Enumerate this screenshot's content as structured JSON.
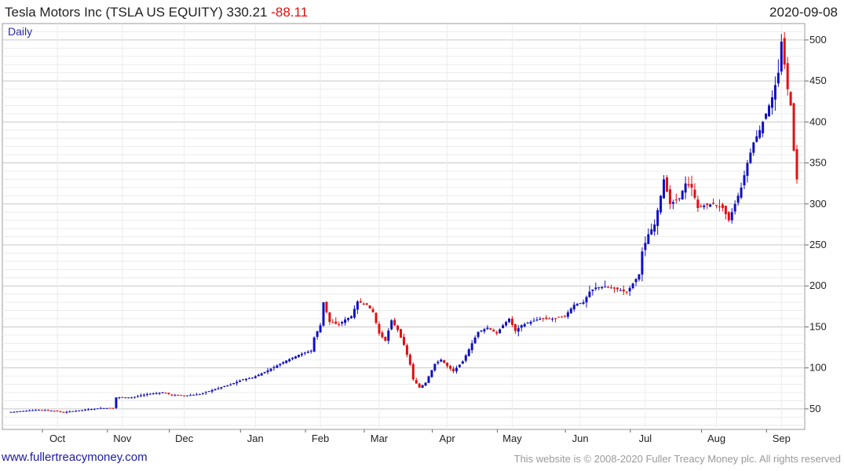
{
  "header": {
    "title": "Tesla Motors Inc (TSLA US EQUITY)",
    "last": "330.21",
    "change": "-88.11",
    "date": "2020-09-08"
  },
  "footer": {
    "site": "www.fullertreacymoney.com",
    "copyright": "This website is © 2008-2020 Fuller Treacy Money plc. All rights reserved"
  },
  "colors": {
    "up": "#1010c0",
    "down": "#e01010",
    "grid": "#d6d6d6"
  },
  "chart_data": {
    "type": "candlestick",
    "period_label": "Daily",
    "ylim": [
      25,
      520
    ],
    "yticks": [
      50,
      100,
      150,
      200,
      250,
      300,
      350,
      400,
      450,
      500
    ],
    "grid": true,
    "axis_side": "right",
    "months": [
      "Oct",
      "Nov",
      "Dec",
      "Jan",
      "Feb",
      "Mar",
      "Apr",
      "May",
      "Jun",
      "Jul",
      "Aug",
      "Sep"
    ],
    "month_index": [
      16,
      37,
      57,
      80,
      101,
      120,
      142,
      163,
      185,
      206,
      229,
      250
    ],
    "x_count": 254,
    "anchors": [
      [
        0,
        46
      ],
      [
        10,
        49
      ],
      [
        14,
        48
      ],
      [
        16,
        47
      ],
      [
        18,
        46
      ],
      [
        25,
        49
      ],
      [
        30,
        51
      ],
      [
        34,
        51
      ],
      [
        35,
        64
      ],
      [
        40,
        64
      ],
      [
        45,
        68
      ],
      [
        50,
        70
      ],
      [
        53,
        67
      ],
      [
        57,
        66
      ],
      [
        62,
        68
      ],
      [
        66,
        73
      ],
      [
        72,
        80
      ],
      [
        76,
        86
      ],
      [
        79,
        88
      ],
      [
        83,
        95
      ],
      [
        86,
        101
      ],
      [
        90,
        109
      ],
      [
        94,
        116
      ],
      [
        98,
        121
      ],
      [
        99,
        137
      ],
      [
        101,
        152
      ],
      [
        102,
        180
      ],
      [
        104,
        156
      ],
      [
        107,
        153
      ],
      [
        109,
        159
      ],
      [
        111,
        163
      ],
      [
        113,
        181
      ],
      [
        116,
        177
      ],
      [
        118,
        168
      ],
      [
        120,
        142
      ],
      [
        122,
        133
      ],
      [
        124,
        158
      ],
      [
        126,
        146
      ],
      [
        128,
        128
      ],
      [
        130,
        104
      ],
      [
        131,
        86
      ],
      [
        133,
        76
      ],
      [
        135,
        82
      ],
      [
        138,
        105
      ],
      [
        140,
        110
      ],
      [
        142,
        102
      ],
      [
        144,
        96
      ],
      [
        147,
        108
      ],
      [
        150,
        130
      ],
      [
        152,
        144
      ],
      [
        155,
        149
      ],
      [
        158,
        142
      ],
      [
        160,
        152
      ],
      [
        162,
        160
      ],
      [
        164,
        145
      ],
      [
        166,
        152
      ],
      [
        168,
        155
      ],
      [
        172,
        160
      ],
      [
        176,
        160
      ],
      [
        180,
        163
      ],
      [
        183,
        177
      ],
      [
        186,
        180
      ],
      [
        188,
        193
      ],
      [
        190,
        198
      ],
      [
        193,
        199
      ],
      [
        197,
        196
      ],
      [
        200,
        192
      ],
      [
        204,
        214
      ],
      [
        205,
        242
      ],
      [
        207,
        263
      ],
      [
        209,
        275
      ],
      [
        211,
        310
      ],
      [
        212,
        330
      ],
      [
        214,
        300
      ],
      [
        217,
        307
      ],
      [
        219,
        325
      ],
      [
        221,
        320
      ],
      [
        223,
        295
      ],
      [
        225,
        298
      ],
      [
        228,
        300
      ],
      [
        231,
        295
      ],
      [
        233,
        280
      ],
      [
        235,
        300
      ],
      [
        237,
        320
      ],
      [
        239,
        350
      ],
      [
        241,
        375
      ],
      [
        243,
        390
      ],
      [
        245,
        410
      ],
      [
        247,
        430
      ],
      [
        249,
        460
      ],
      [
        250,
        498
      ],
      [
        251,
        470
      ],
      [
        252,
        440
      ],
      [
        253,
        420
      ],
      [
        254,
        365
      ],
      [
        255,
        330
      ]
    ]
  }
}
